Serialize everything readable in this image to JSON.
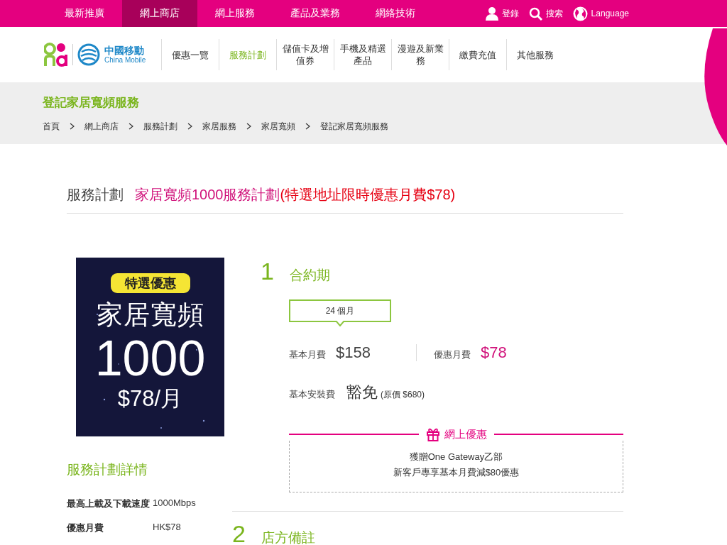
{
  "top_nav": {
    "items": [
      {
        "label": "最新推廣",
        "selected": false
      },
      {
        "label": "網上商店",
        "selected": true
      },
      {
        "label": "網上服務",
        "selected": false
      },
      {
        "label": "產品及業務",
        "selected": false
      },
      {
        "label": "網絡技術",
        "selected": false
      }
    ],
    "actions": [
      {
        "kind": "user",
        "label": "登錄"
      },
      {
        "kind": "search",
        "label": "搜索"
      },
      {
        "kind": "globe",
        "label": "Language"
      }
    ]
  },
  "brand": {
    "name": "中國移動",
    "name_en": "China Mobile"
  },
  "main_nav": [
    {
      "label": "優惠一覽",
      "selected": false
    },
    {
      "label": "服務計劃",
      "selected": true
    },
    {
      "label": "儲值卡及增值券",
      "selected": false
    },
    {
      "label": "手機及精選產品",
      "selected": false
    },
    {
      "label": "漫遊及新業務",
      "selected": false
    },
    {
      "label": "繳費充值",
      "selected": false
    },
    {
      "label": "其他服務",
      "selected": false
    }
  ],
  "page_title": "登記家居寬頻服務",
  "breadcrumb": [
    "首頁",
    "網上商店",
    "服務計劃",
    "家居服務",
    "家居寬頻",
    "登記家居寬頻服務"
  ],
  "plan_heading": {
    "label": "服務計劃",
    "name": "家居寬頻1000服務計劃",
    "note": "(特選地址限時優惠月費$78)"
  },
  "banner": {
    "tag": "特選優惠",
    "title": "家居寬頻",
    "speed": "1000",
    "price": "$78/月"
  },
  "details": {
    "title": "服務計劃詳情",
    "rows": [
      {
        "label": "最高上載及下載速度",
        "value": "1000Mbps"
      },
      {
        "label": "優惠月費",
        "value": "HK$78"
      }
    ]
  },
  "steps": [
    {
      "number": "1",
      "title": "合約期",
      "options": [
        {
          "label": "24 個月",
          "selected": true
        }
      ],
      "base_fee_label": "基本月費",
      "base_fee": "$158",
      "promo_fee_label": "優惠月費",
      "promo_fee": "$78",
      "install_label": "基本安裝費",
      "install_value": "豁免",
      "install_note": "(原價 $680)",
      "offer": {
        "title": "網上優惠",
        "lines": [
          "獲贈One Gateway乙部",
          "新客戶專享基本月費減$80優惠"
        ]
      }
    },
    {
      "number": "2",
      "title": "店方備註"
    }
  ]
}
